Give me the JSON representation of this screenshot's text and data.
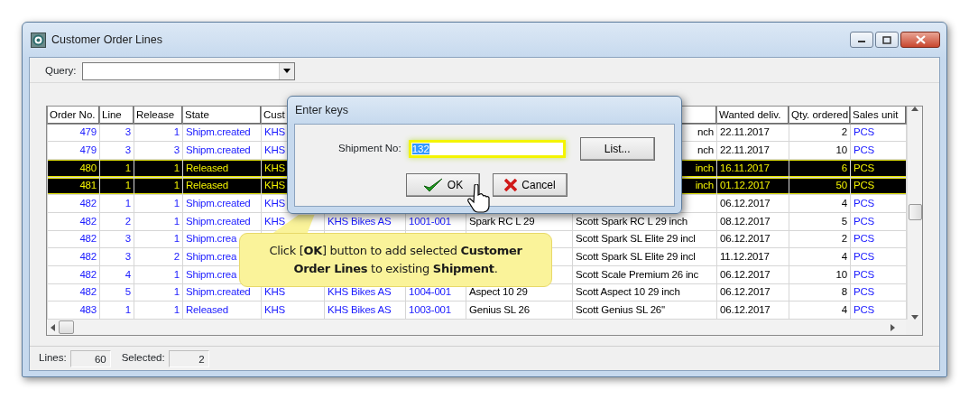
{
  "window": {
    "title": "Customer Order Lines"
  },
  "query": {
    "label": "Query:"
  },
  "table": {
    "columns": [
      "Order No.",
      "Line",
      "Release",
      "State",
      "Cust",
      null,
      null,
      null,
      null,
      "Wanted deliv.",
      "Qty. ordered",
      "Sales unit"
    ],
    "rows": [
      {
        "selected": false,
        "cells": [
          "479",
          "3",
          "1",
          "Shipm.created",
          "KHS",
          null,
          null,
          null,
          {
            "text": "nch",
            "clipped_start": true
          },
          "22.11.2017",
          "2",
          "PCS"
        ]
      },
      {
        "selected": false,
        "cells": [
          "479",
          "3",
          "3",
          "Shipm.created",
          "KHS",
          null,
          null,
          null,
          {
            "text": "nch",
            "clipped_start": true
          },
          "22.11.2017",
          "10",
          "PCS"
        ]
      },
      {
        "selected": true,
        "cells": [
          "480",
          "1",
          "1",
          "Released",
          "KHS",
          null,
          null,
          null,
          {
            "text": "inch",
            "clipped_start": true
          },
          "16.11.2017",
          "6",
          "PCS"
        ]
      },
      {
        "selected": true,
        "cells": [
          "481",
          "1",
          "1",
          "Released",
          "KHS",
          null,
          null,
          null,
          {
            "text": "inch",
            "clipped_start": true
          },
          "01.12.2017",
          "50",
          "PCS"
        ]
      },
      {
        "selected": false,
        "cells": [
          "482",
          "1",
          "1",
          "Shipm.created",
          "KHS",
          null,
          null,
          null,
          null,
          "06.12.2017",
          "4",
          "PCS"
        ]
      },
      {
        "selected": false,
        "cells": [
          "482",
          "2",
          "1",
          "Shipm.created",
          "KHS",
          "KHS Bikes AS",
          "1001-001",
          "Spark RC L 29",
          "Scott Spark RC L 29 inch",
          "08.12.2017",
          "5",
          "PCS"
        ]
      },
      {
        "selected": false,
        "cells": [
          "482",
          "3",
          "1",
          "Shipm.crea",
          null,
          null,
          null,
          null,
          "Scott Spark SL Elite 29 incl",
          "06.12.2017",
          "2",
          "PCS"
        ]
      },
      {
        "selected": false,
        "cells": [
          "482",
          "3",
          "2",
          "Shipm.crea",
          null,
          null,
          null,
          null,
          "Scott Spark SL Elite 29 incl",
          "11.12.2017",
          "4",
          "PCS"
        ]
      },
      {
        "selected": false,
        "cells": [
          "482",
          "4",
          "1",
          "Shipm.crea",
          null,
          null,
          null,
          null,
          "Scott Scale Premium 26 inc",
          "06.12.2017",
          "10",
          "PCS"
        ]
      },
      {
        "selected": false,
        "cells": [
          "482",
          "5",
          "1",
          "Shipm.created",
          "KHS",
          "KHS Bikes AS",
          "1004-001",
          "Aspect 10 29",
          "Scott Aspect 10 29 inch",
          "06.12.2017",
          "8",
          "PCS"
        ]
      },
      {
        "selected": false,
        "cells": [
          "483",
          "1",
          "1",
          "Released",
          "KHS",
          "KHS Bikes AS",
          "1003-001",
          "Genius SL 26",
          "Scott Genius SL 26''",
          "06.12.2017",
          "4",
          "PCS"
        ]
      }
    ]
  },
  "status_bar": {
    "lines_label": "Lines:",
    "lines": "60",
    "selected_label": "Selected:",
    "selected": "2"
  },
  "dialog": {
    "title": "Enter keys",
    "field_label": "Shipment No:",
    "field_value": "132",
    "text_selected": true,
    "buttons": [
      {
        "kind": "list",
        "label": "List..."
      },
      {
        "kind": "ok",
        "label": "OK"
      },
      {
        "kind": "cancel",
        "label": "Cancel"
      }
    ]
  },
  "callout": {
    "text": "Click [**OK**] button to add selected **Customer Order Lines** to existing **Shipment**."
  }
}
